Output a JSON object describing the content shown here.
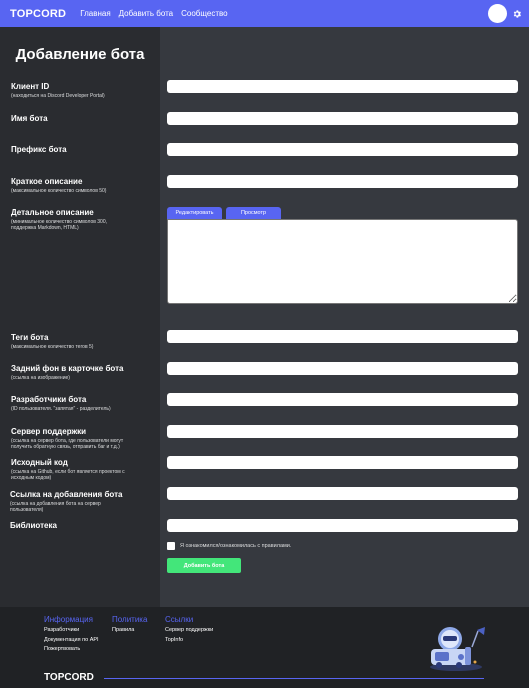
{
  "nav": {
    "logo": "TOPCORD",
    "links": [
      "Главная",
      "Добавить бота",
      "Сообщество"
    ]
  },
  "page": {
    "title": "Добавление бота"
  },
  "form": {
    "client_id": {
      "label": "Клиент ID",
      "hint": "(находиться на Discord Developer Portal)"
    },
    "bot_name": {
      "label": "Имя бота"
    },
    "prefix": {
      "label": "Префикс бота"
    },
    "short_desc": {
      "label": "Краткое описание",
      "hint": "(максимальное количество символов 50)"
    },
    "long_desc": {
      "label": "Детальное описание",
      "hint_1": "(минимальное количество символов 300,",
      "hint_2": "поддержка Markdown, HTML)",
      "tab_edit": "Редактировать",
      "tab_preview": "Просмотр"
    },
    "tags": {
      "label": "Теги бота",
      "hint": "(максимальное количество тегов 5)"
    },
    "background": {
      "label": "Задний фон в карточке бота",
      "hint": "(ссылка на изображение)"
    },
    "developers": {
      "label": "Разработчики бота",
      "hint": "(ID пользователя. \"запятая\" - разделитель)"
    },
    "support": {
      "label": "Сервер поддержки",
      "hint_1": "(ссылка на сервер бота, где пользователи могут",
      "hint_2": "получить обратную связь, отправить баг и т.д.)"
    },
    "source": {
      "label": "Исходный код",
      "hint_1": "(ссылка на Github, если бот является проектом с",
      "hint_2": "исходным кодом)"
    },
    "invite": {
      "label": "Ссылка на добавления бота",
      "hint_1": "(ссылка на добавления бота на сервер",
      "hint_2": "пользователя)"
    },
    "library": {
      "label": "Библиотека"
    },
    "agree": "Я ознакомился/ознакомилась с правилами.",
    "submit": "Добавить бота"
  },
  "footer": {
    "col1": {
      "title": "Информация",
      "links": [
        "Разработчики",
        "Документация по API",
        "Пожертвовать"
      ]
    },
    "col2": {
      "title": "Политика",
      "links": [
        "Правила"
      ]
    },
    "col3": {
      "title": "Ссылки",
      "links": [
        "Сервер поддержки",
        "TopInfo"
      ]
    },
    "logo": "TOPCORD"
  },
  "colors": {
    "accent": "#5865f2",
    "submit": "#43e67a",
    "sidebar": "#2a2c30",
    "content": "#36393f",
    "background": "#202225"
  },
  "icons": {
    "settings": "gear-icon",
    "mascot": "robot-mascot-illustration"
  }
}
